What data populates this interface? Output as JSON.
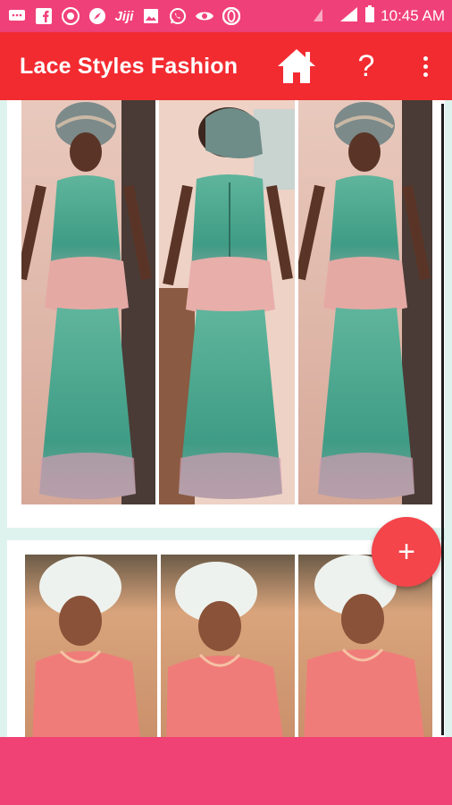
{
  "status_bar": {
    "time": "10:45 AM",
    "icons": [
      "message-icon",
      "facebook-icon",
      "gallery-app-icon",
      "compass-icon",
      "jiji-app-icon",
      "image-icon",
      "whatsapp-icon",
      "eye-icon",
      "opera-icon"
    ],
    "jiji_text": "Jiji",
    "signal_icon": "signal-icon",
    "battery_icon": "battery-icon"
  },
  "app_bar": {
    "title": "Lace Styles Fashion",
    "help_label": "?",
    "home_icon": "home-icon",
    "more_icon": "more-vert-icon"
  },
  "fab": {
    "label": "+"
  },
  "colors": {
    "status_bar": "#f0407a",
    "app_bar": "#f22b31",
    "fab": "#f3454a",
    "bottom_bar": "#f04275",
    "list_bg": "#dff3ee"
  },
  "gallery": {
    "items": [
      {
        "description_icon": "photo-green-peplum-lace-gown"
      },
      {
        "description_icon": "photo-pink-lace-dress-white-gele"
      }
    ]
  }
}
